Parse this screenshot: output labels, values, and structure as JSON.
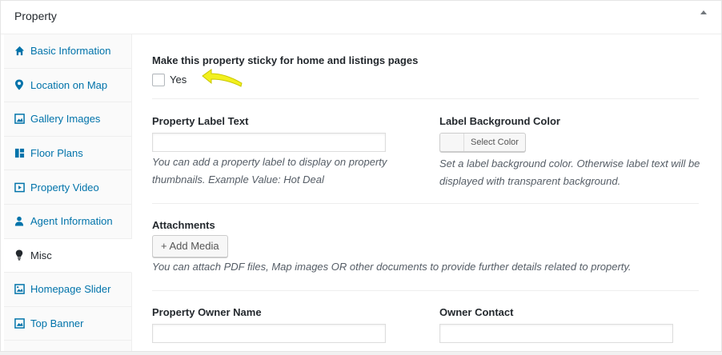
{
  "postbox": {
    "title": "Property"
  },
  "tabs": [
    {
      "label": "Basic Information",
      "icon": "home-icon"
    },
    {
      "label": "Location on Map",
      "icon": "map-pin-icon"
    },
    {
      "label": "Gallery Images",
      "icon": "gallery-icon"
    },
    {
      "label": "Floor Plans",
      "icon": "floor-plan-icon"
    },
    {
      "label": "Property Video",
      "icon": "video-icon"
    },
    {
      "label": "Agent Information",
      "icon": "agent-icon"
    },
    {
      "label": "Misc",
      "icon": "lightbulb-icon",
      "active": true
    },
    {
      "label": "Homepage Slider",
      "icon": "slider-icon"
    },
    {
      "label": "Top Banner",
      "icon": "banner-icon"
    }
  ],
  "sticky": {
    "label": "Make this property sticky for home and listings pages",
    "checkbox_label": "Yes",
    "checked": false
  },
  "label_text": {
    "label": "Property Label Text",
    "value": "",
    "hint": "You can add a property label to display on property thumbnails. Example Value: Hot Deal"
  },
  "label_bg": {
    "label": "Label Background Color",
    "button": "Select Color",
    "hint": "Set a label background color. Otherwise label text will be displayed with transparent background."
  },
  "attachments": {
    "label": "Attachments",
    "button": "+ Add Media",
    "hint": "You can attach PDF files, Map images OR other documents to provide further details related to property."
  },
  "owner_name": {
    "label": "Property Owner Name",
    "value": ""
  },
  "owner_contact": {
    "label": "Owner Contact",
    "value": ""
  },
  "colors": {
    "accent": "#0073aa",
    "annotation": "#f2f01e"
  }
}
